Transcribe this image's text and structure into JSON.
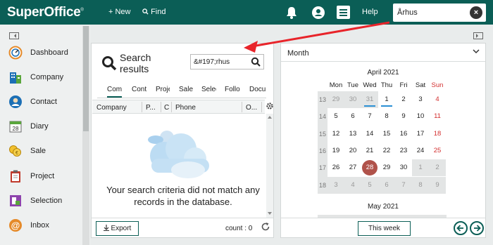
{
  "topbar": {
    "logo": "SuperOffice",
    "logo_mark": "®",
    "new_label": "+ New",
    "find_label": "Find",
    "help_label": "Help",
    "search_value": "Århus",
    "bell_icon": "bell-icon",
    "user_icon": "user-icon",
    "menu_icon": "hamburger-icon"
  },
  "sidebar": {
    "items": [
      {
        "label": "Dashboard",
        "icon": "gauge-icon"
      },
      {
        "label": "Company",
        "icon": "building-icon"
      },
      {
        "label": "Contact",
        "icon": "person-icon"
      },
      {
        "label": "Diary",
        "icon": "calendar-icon",
        "icon_text": "28"
      },
      {
        "label": "Sale",
        "icon": "coins-icon"
      },
      {
        "label": "Project",
        "icon": "clipboard-icon"
      },
      {
        "label": "Selection",
        "icon": "selection-icon"
      },
      {
        "label": "Inbox",
        "icon": "at-icon"
      }
    ]
  },
  "results": {
    "title_line1": "Search",
    "title_line2": "results",
    "search_value": "&#197;rhus",
    "tabs": [
      "Comp",
      "Cont",
      "Proje",
      "Sale",
      "Selec",
      "Follo",
      "Docu"
    ],
    "columns": [
      "Company",
      "P...",
      "C",
      "Phone",
      "O..."
    ],
    "empty_message": "Your search criteria did not match any records in the database.",
    "export_label": "Export",
    "count_label": "count : 0"
  },
  "calendar": {
    "mode_label": "Month",
    "month1_title": "April 2021",
    "month2_title": "May 2021",
    "weekdays": [
      "Mon",
      "Tue",
      "Wed",
      "Thu",
      "Fri",
      "Sat",
      "Sun"
    ],
    "weeks": [
      {
        "week": "13",
        "days": [
          "29",
          "30",
          "31",
          "1",
          "2",
          "3",
          "4"
        ]
      },
      {
        "week": "14",
        "days": [
          "5",
          "6",
          "7",
          "8",
          "9",
          "10",
          "11"
        ]
      },
      {
        "week": "15",
        "days": [
          "12",
          "13",
          "14",
          "15",
          "16",
          "17",
          "18"
        ]
      },
      {
        "week": "16",
        "days": [
          "19",
          "20",
          "21",
          "22",
          "23",
          "24",
          "25"
        ]
      },
      {
        "week": "17",
        "days": [
          "26",
          "27",
          "28",
          "29",
          "30",
          "1",
          "2"
        ]
      },
      {
        "week": "18",
        "days": [
          "3",
          "4",
          "5",
          "6",
          "7",
          "8",
          "9"
        ]
      }
    ],
    "today": "28",
    "this_week_label": "This week",
    "colors": {
      "accent": "#0b5e56",
      "sunday": "#d32f2f",
      "today": "#b0524a",
      "event_bar": "#2a8fd4",
      "dim": "#999999"
    }
  }
}
